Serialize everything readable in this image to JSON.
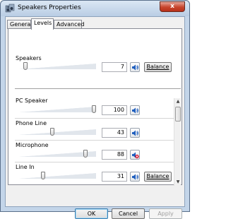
{
  "window": {
    "title": "Speakers Properties",
    "close_glyph": "x"
  },
  "tabs": [
    {
      "label": "General",
      "active": false
    },
    {
      "label": "Levels",
      "active": true
    },
    {
      "label": "Advanced",
      "active": false
    }
  ],
  "master": {
    "label": "Speakers",
    "value": "7",
    "balance_label": "Balance",
    "muted": false,
    "level": 0.07
  },
  "devices": [
    {
      "label": "PC Speaker",
      "value": "100",
      "level": 1.0,
      "muted": false,
      "has_balance": false
    },
    {
      "label": "Phone Line",
      "value": "43",
      "level": 0.43,
      "muted": false,
      "has_balance": false
    },
    {
      "label": "Microphone",
      "value": "88",
      "level": 0.88,
      "muted": true,
      "has_balance": false
    },
    {
      "label": "Line In",
      "value": "31",
      "level": 0.31,
      "muted": false,
      "has_balance": true,
      "balance_label": "Balance"
    }
  ],
  "footer": {
    "ok_label": "OK",
    "cancel_label": "Cancel",
    "apply_label": "Apply"
  },
  "icons": {
    "window": "speaker-window-icon",
    "speaker": "speaker-icon",
    "muted": "speaker-muted-icon"
  },
  "colors": {
    "accent": "#1f5fbf",
    "mute_red": "#d6001c"
  }
}
